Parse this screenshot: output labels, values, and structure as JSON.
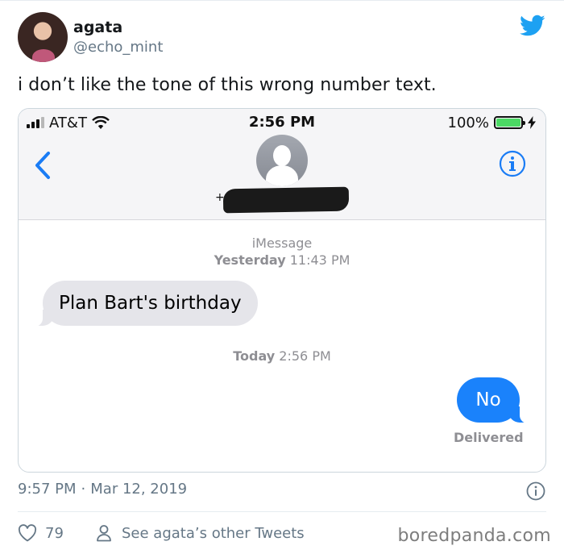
{
  "author": {
    "display_name": "agata",
    "handle": "@echo_mint"
  },
  "tweet": {
    "text": "i don’t like the tone of this wrong number text.",
    "time": "9:57 PM",
    "separator": "·",
    "date": "Mar 12, 2019",
    "like_count": "79",
    "profile_link": "See agata’s other Tweets"
  },
  "phone": {
    "carrier": "AT&T",
    "time": "2:56 PM",
    "battery": "100%",
    "battery_level": 1.0,
    "contact_prefix": "+",
    "service": "iMessage",
    "messages": [
      {
        "day": "Yesterday",
        "time": "11:43 PM",
        "text": "Plan Bart's birthday",
        "direction": "incoming"
      },
      {
        "day": "Today",
        "time": "2:56 PM",
        "text": "No",
        "direction": "outgoing",
        "status": "Delivered"
      }
    ]
  },
  "watermark": "boredpanda.com",
  "colors": {
    "twitter_blue": "#1da1f2",
    "imessage_blue": "#1a82fb",
    "incoming_bubble": "#e5e5ea",
    "ios_tint": "#1a7cf5",
    "battery_green": "#4cd964",
    "secondary_text": "#657786"
  },
  "icons": [
    "twitter-bird-icon",
    "wifi-icon",
    "battery-icon",
    "charging-bolt-icon",
    "back-chevron-icon",
    "contact-avatar-icon",
    "info-icon",
    "heart-icon",
    "person-icon"
  ]
}
